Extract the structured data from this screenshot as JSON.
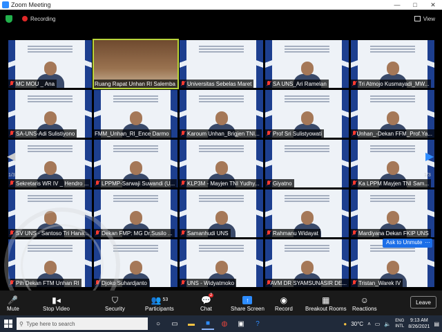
{
  "window": {
    "title": "Zoom Meeting"
  },
  "topbar": {
    "recording_label": "Recording",
    "view_label": "View"
  },
  "gallery": {
    "page_indicator": "1/3",
    "tiles": [
      {
        "name": "MC MOU _ Ana",
        "muted": true,
        "kind": "slide-person"
      },
      {
        "name": "Ruang Rapat Unhan RI Salemba",
        "muted": false,
        "kind": "room",
        "active": true
      },
      {
        "name": "Universitas Sebelas Maret",
        "muted": true,
        "kind": "slide"
      },
      {
        "name": "SA UNS_Ari Ramelan",
        "muted": true,
        "kind": "slide-person"
      },
      {
        "name": "Tri Atmojo Kusmayadi_MW...",
        "muted": true,
        "kind": "slide-person"
      },
      {
        "name": "SA-UNS-Adi Sulistiyono",
        "muted": true,
        "kind": "slide-person"
      },
      {
        "name": "FMM_Unhan_RI_Ence Darmo",
        "muted": false,
        "kind": "slide-person"
      },
      {
        "name": "Karoum Unhan_Brigjen TNI...",
        "muted": true,
        "kind": "slide-person"
      },
      {
        "name": "Prof Sri Sulistyowati",
        "muted": true,
        "kind": "slide-person"
      },
      {
        "name": "Unhan_-Dekan FFM_Prof.Ya...",
        "muted": true,
        "kind": "slide-person"
      },
      {
        "name": "Sekretaris WR IV _ Hendro ...",
        "muted": true,
        "kind": "slide-person"
      },
      {
        "name": "LPPMP-Sarwaji Suwandi (U...",
        "muted": true,
        "kind": "slide-person"
      },
      {
        "name": "KLP3M - Mayjen TNI Yudhy...",
        "muted": true,
        "kind": "slide-person"
      },
      {
        "name": "Giyatno",
        "muted": true,
        "kind": "slide"
      },
      {
        "name": "Ka LPPM Mayjen TNI Sam...",
        "muted": true,
        "kind": "slide-person"
      },
      {
        "name": "SV UNS - Santoso Tri Hana...",
        "muted": true,
        "kind": "slide-person"
      },
      {
        "name": "Dekan FMP: MG Dr.Susilo ...",
        "muted": true,
        "kind": "slide-person"
      },
      {
        "name": "Samanhudi UNS",
        "muted": true,
        "kind": "slide-person"
      },
      {
        "name": "Rahmanu Widayat",
        "muted": true,
        "kind": "slide-person"
      },
      {
        "name": "Mardiyana Dekan FKIP UNS",
        "muted": true,
        "kind": "slide-person"
      },
      {
        "name": "Pih Dekan FTM Unhan RI",
        "muted": true,
        "kind": "slide-person"
      },
      {
        "name": "Djoko Suhardjanto",
        "muted": true,
        "kind": "slide-person"
      },
      {
        "name": "UNS - Widyatmoko",
        "muted": true,
        "kind": "slide-person"
      },
      {
        "name": "AVM DR SYAMSUNASIR DE...",
        "muted": true,
        "kind": "slide-person"
      },
      {
        "name": "Tristan_Warek IV",
        "muted": true,
        "kind": "slide-person"
      }
    ],
    "slide_title": "PENANDATANGANAN NOTA KESEPAHAMAN",
    "unmute_prompt": "Ask to Unmute"
  },
  "toolbar": {
    "mute_label": "Mute",
    "video_label": "Stop Video",
    "security_label": "Security",
    "participants_label": "Participants",
    "participants_count": "53",
    "chat_label": "Chat",
    "chat_badge": "2",
    "share_label": "Share Screen",
    "record_label": "Record",
    "breakout_label": "Breakout Rooms",
    "reactions_label": "Reactions",
    "leave_label": "Leave"
  },
  "taskbar": {
    "search_placeholder": "Type here to search",
    "weather": "30°C",
    "lang_top": "ENG",
    "lang_bottom": "INTL",
    "time": "9:13 AM",
    "date": "8/26/2021"
  },
  "colors": {
    "active_speaker": "#b9d63a",
    "zoom_blue": "#2d8cff",
    "muted_red": "#ff3b30"
  },
  "watermark": {
    "text": "UNIVERSITAS PERTAHANAN REPUBLIK INDONESIA"
  }
}
